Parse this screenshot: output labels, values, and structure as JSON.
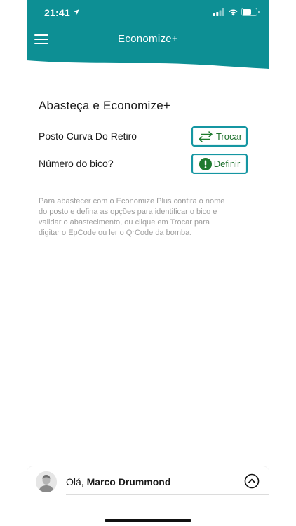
{
  "status_bar": {
    "time": "21:41"
  },
  "header": {
    "title": "Economize+",
    "menu_icon": "hamburger-menu-icon",
    "color": "#0d8f94"
  },
  "main": {
    "title": "Abasteça e Economize+",
    "station": {
      "label": "Posto Curva Do Retiro",
      "button_label": "Trocar",
      "button_icon": "swap-arrows-icon"
    },
    "nozzle": {
      "label": "Número do bico?",
      "button_label": "Definir",
      "button_icon": "alert-icon"
    },
    "help_lines": [
      "Para abastecer com o Economize Plus confira o nome",
      "do posto e defina as opções para identificar o bico e",
      "validar o abastecimento, ou clique em Trocar para",
      "digitar o EpCode ou ler o QrCode da bomba."
    ]
  },
  "footer": {
    "greeting": "Olá,",
    "user_name": "Marco Drummond",
    "expand_icon": "chevron-up-circle-icon"
  },
  "colors": {
    "accent": "#0d8f94",
    "button_border": "#1596a2",
    "button_text": "#21722f",
    "alert": "#1e7a2e",
    "help_text": "#9c9c9c"
  }
}
